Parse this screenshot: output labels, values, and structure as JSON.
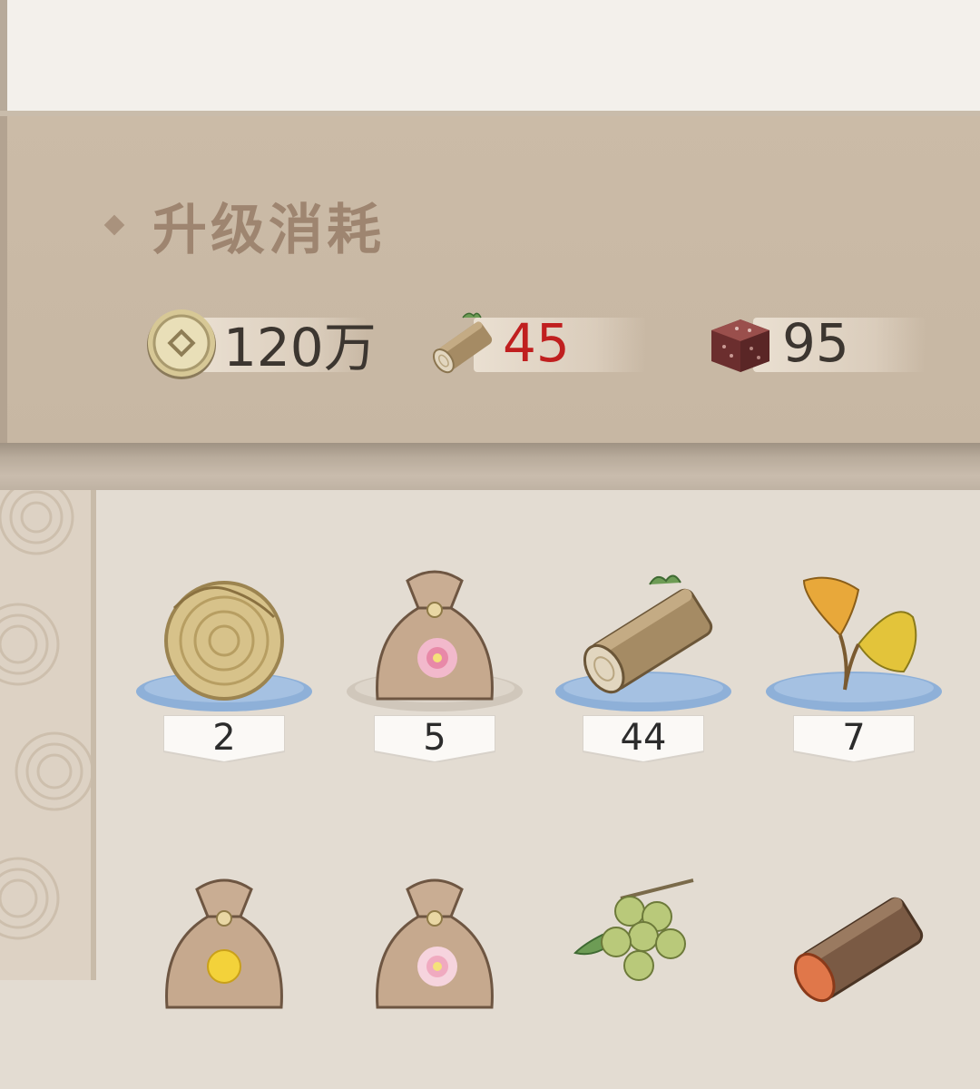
{
  "upgrade_cost": {
    "title": "升级消耗",
    "items": [
      {
        "icon": "coin-icon",
        "value": "120万",
        "color": "#3c3630"
      },
      {
        "icon": "wood-log-icon",
        "value": "45",
        "color": "#c01f1f"
      },
      {
        "icon": "meat-cube-icon",
        "value": "95",
        "color": "#3c3630"
      }
    ]
  },
  "inventory": {
    "items": [
      {
        "icon": "straw-bundle-icon",
        "count": "2"
      },
      {
        "icon": "flower-pouch-icon",
        "count": "5"
      },
      {
        "icon": "wood-log-icon",
        "count": "44"
      },
      {
        "icon": "ginkgo-leaf-icon",
        "count": "7"
      },
      {
        "icon": "sun-pouch-icon",
        "count": ""
      },
      {
        "icon": "flower-pouch-icon",
        "count": ""
      },
      {
        "icon": "grape-cluster-icon",
        "count": ""
      },
      {
        "icon": "red-wood-log-icon",
        "count": ""
      }
    ]
  },
  "colors": {
    "panel": "#c9b9a6",
    "bag_bg": "#e3dcd2",
    "pedestal_blue": "#8eb0d8",
    "warning_red": "#c01f1f"
  }
}
